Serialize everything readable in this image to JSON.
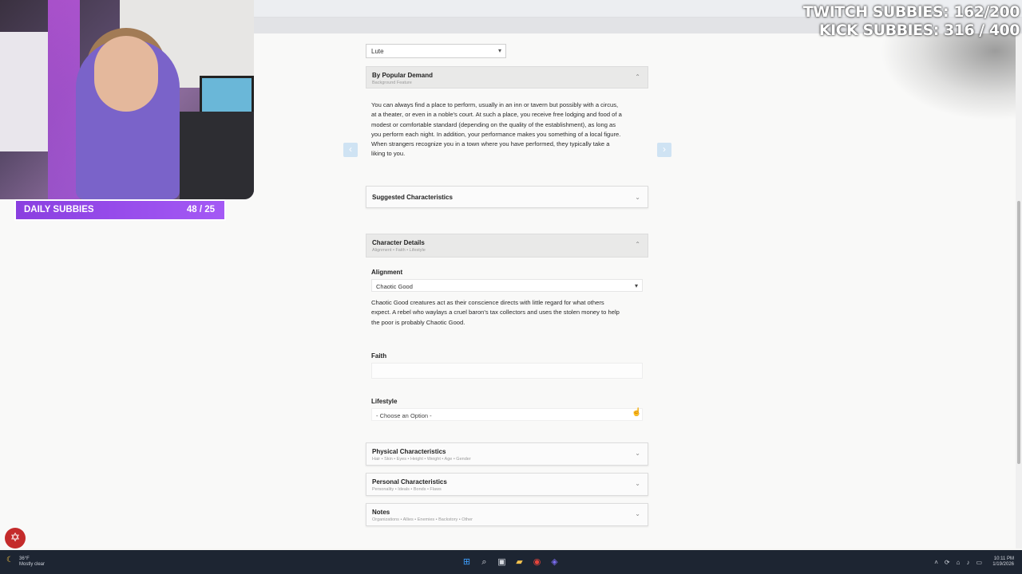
{
  "stream": {
    "daily_subbies_label": "DAILY SUBBIES",
    "daily_subbies_count": "48 / 25",
    "twitch_subbies": "TWITCH SUBBIES: 162/200",
    "kick_subbies": "KICK SUBBIES: 316 / 400"
  },
  "instrument_select": {
    "value": "Lute"
  },
  "by_popular_demand": {
    "title": "By Popular Demand",
    "subtitle": "Background Feature",
    "line1": "You can always find a place to perform, usually in an inn or tavern but possibly with a circus,",
    "line2": "at a theater, or even in a noble's court. At such a place, you receive free lodging and food of a",
    "line3": "modest or comfortable standard (depending on the quality of the establishment), as long as",
    "line4": "you perform each night. In addition, your performance makes you something of a local figure.",
    "line5": "When strangers recognize you in a town where you have performed, they typically take a",
    "line6": "liking to you."
  },
  "nav": {
    "prev": "‹",
    "next": "›"
  },
  "suggested": {
    "title": "Suggested Characteristics"
  },
  "character_details": {
    "title": "Character Details",
    "subtitle": "Alignment • Faith • Lifestyle",
    "alignment_label": "Alignment",
    "alignment_value": "Chaotic Good",
    "alignment_line1": "Chaotic Good creatures act as their conscience directs with little regard for what others",
    "alignment_line2": "expect. A rebel who waylays a cruel baron's tax collectors and uses the stolen money to help",
    "alignment_line3": "the poor is probably Chaotic Good.",
    "faith_label": "Faith",
    "faith_value": "",
    "lifestyle_label": "Lifestyle",
    "lifestyle_value": "- Choose an Option -"
  },
  "physical": {
    "title": "Physical Characteristics",
    "subtitle": "Hair • Skin • Eyes • Height • Weight • Age • Gender"
  },
  "personal": {
    "title": "Personal Characteristics",
    "subtitle": "Personality • Ideals • Bonds • Flaws"
  },
  "notes": {
    "title": "Notes",
    "subtitle": "Organizations • Allies • Enemies • Backstory • Other"
  },
  "icons": {
    "chevron_down": "⌄",
    "chevron_up": "⌃",
    "caret": "▾"
  },
  "taskbar": {
    "weather_temp": "36°F",
    "weather_desc": "Mostly clear",
    "time": "10:11 PM",
    "date": "1/19/2026"
  }
}
